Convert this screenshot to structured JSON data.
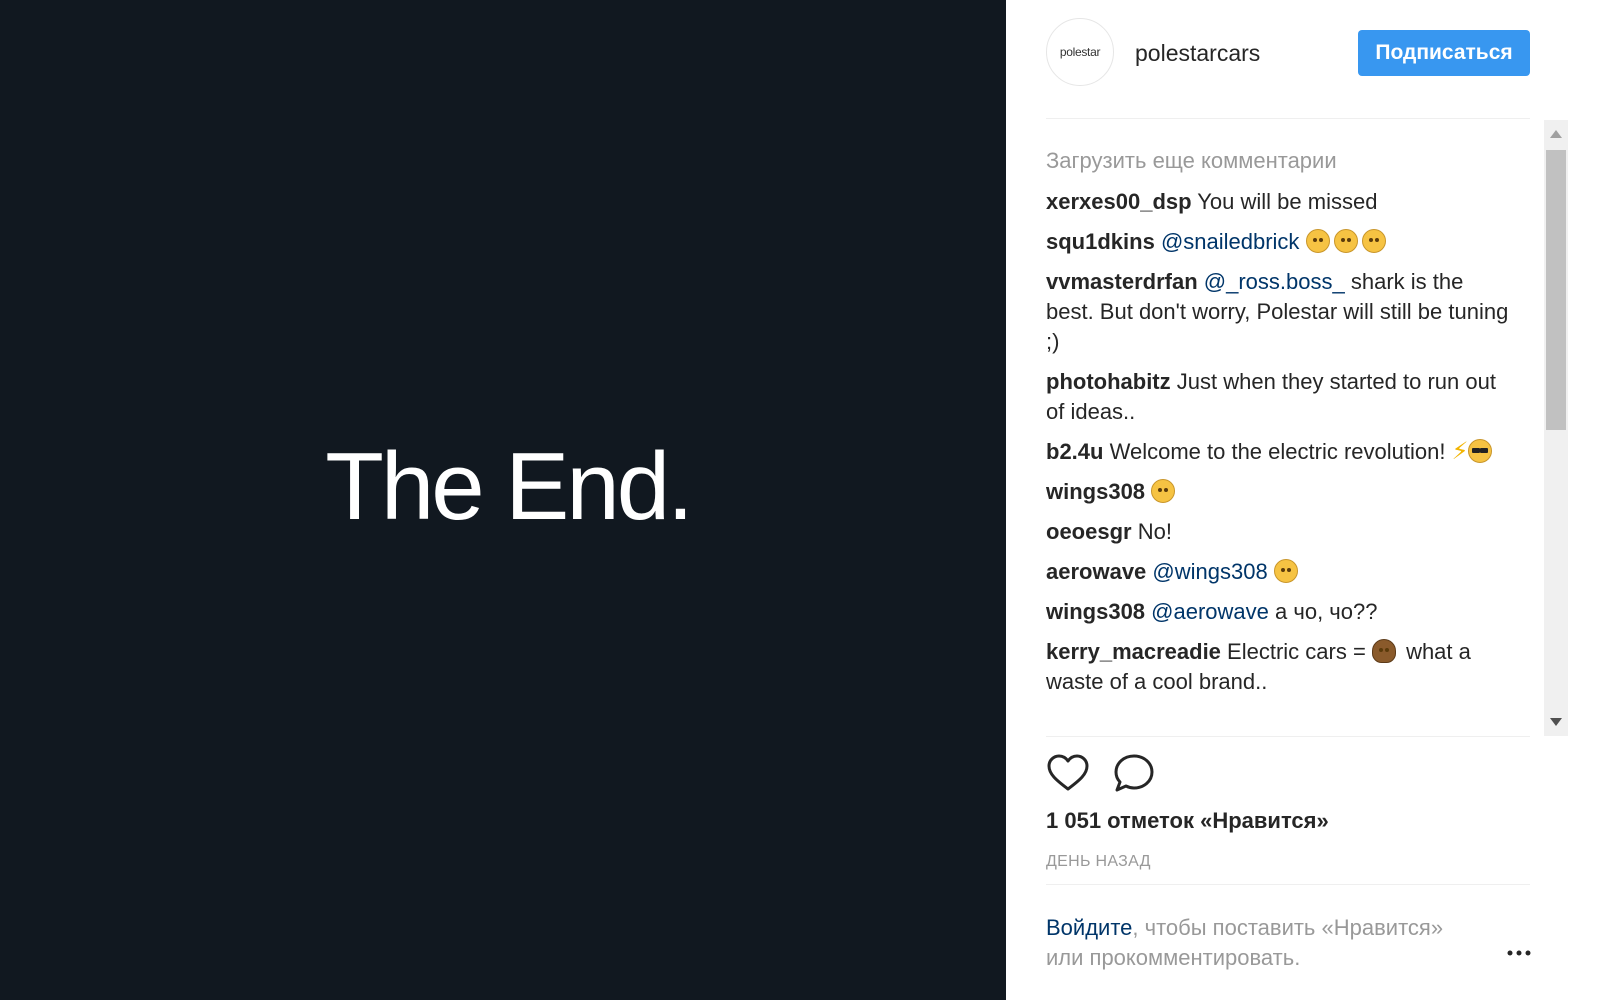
{
  "media": {
    "text": "The End.",
    "background_color": "#111820"
  },
  "header": {
    "avatar_text": "polestar",
    "username": "polestarcars",
    "follow_label": "Подписаться",
    "follow_color": "#3897f0"
  },
  "comments": {
    "load_more": "Загрузить еще комментарии",
    "items": [
      {
        "user": "xerxes00_dsp",
        "text": "You will be missed"
      },
      {
        "user": "squ1dkins",
        "mention": "@snailedbrick",
        "emojis": [
          "crying-face",
          "disappointed-face",
          "disappointed-face"
        ]
      },
      {
        "user": "vvmasterdrfan",
        "mention": "@_ross.boss_",
        "text": "shark is the best. But don't worry, Polestar will still be tuning ;)"
      },
      {
        "user": "photohabitz",
        "text": "Just when they started to run out of ideas.."
      },
      {
        "user": "b2.4u",
        "text": "Welcome to the electric revolution!",
        "emojis": [
          "lightning-bolt",
          "sunglasses-face"
        ]
      },
      {
        "user": "wings308",
        "emojis": [
          "winking-tongue-face"
        ]
      },
      {
        "user": "oeoesgr",
        "text": "No!"
      },
      {
        "user": "aerowave",
        "mention": "@wings308",
        "emojis": [
          "frowning-face"
        ]
      },
      {
        "user": "wings308",
        "mention": "@aerowave",
        "text": "а чо, чо??"
      },
      {
        "user": "kerry_macreadie",
        "text_before": "Electric cars =",
        "emojis": [
          "pile-of-poo"
        ],
        "text_after": "what a waste of a cool brand.."
      }
    ]
  },
  "actions": {
    "like_icon": "heart-icon",
    "comment_icon": "comment-icon"
  },
  "likes": "1 051 отметок «Нравится»",
  "time": "День назад",
  "login": {
    "link": "Войдите",
    "rest": ", чтобы поставить «Нравится» или прокомментировать."
  },
  "more_icon": "more-options-icon"
}
